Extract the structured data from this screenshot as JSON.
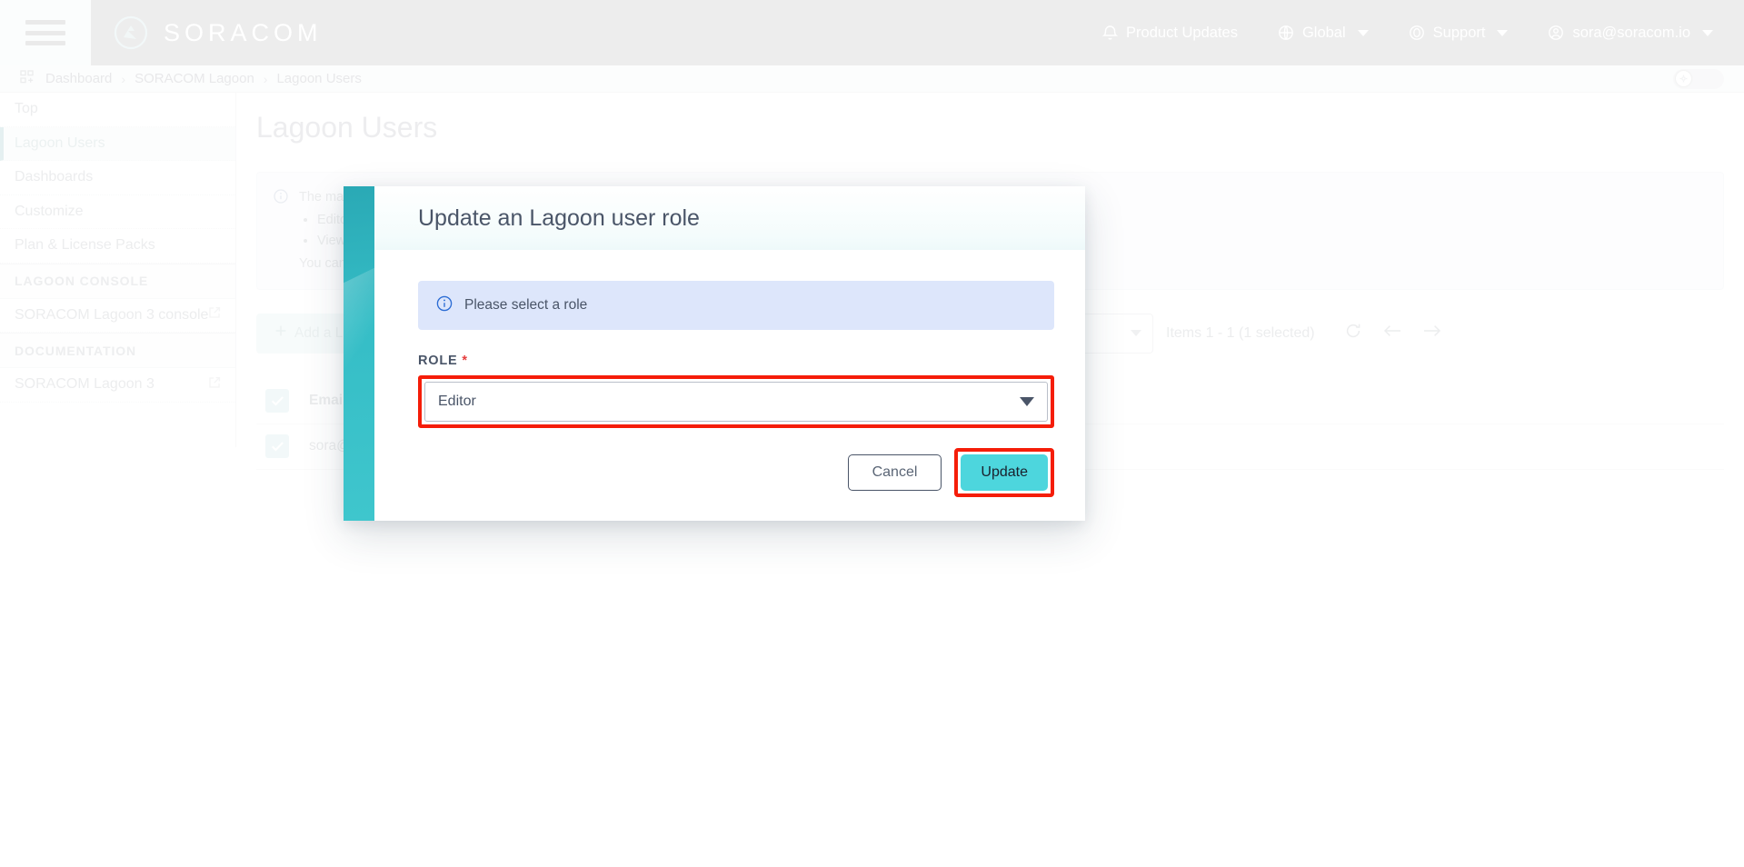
{
  "header": {
    "brand": "SORACOM",
    "menu_icon": "hamburger-icon",
    "logo_icon": "soracom-logo-icon",
    "items": [
      {
        "label": "Product Updates",
        "icon": "bell-icon",
        "has_caret": false
      },
      {
        "label": "Global",
        "icon": "globe-icon",
        "has_caret": true
      },
      {
        "label": "Support",
        "icon": "lifebuoy-icon",
        "has_caret": true
      },
      {
        "label": "sora@soracom.io",
        "icon": "user-circle-icon",
        "has_caret": true
      }
    ]
  },
  "breadcrumb": {
    "icon": "dashboard-grid-icon",
    "items": [
      "Dashboard",
      "SORACOM Lagoon",
      "Lagoon Users"
    ],
    "separator": "›"
  },
  "sidebar": {
    "items": [
      {
        "label": "Top",
        "active": false,
        "external": false
      },
      {
        "label": "Lagoon Users",
        "active": true,
        "external": false
      },
      {
        "label": "Dashboards",
        "active": false,
        "external": false
      },
      {
        "label": "Customize",
        "active": false,
        "external": false
      },
      {
        "label": "Plan & License Packs",
        "active": false,
        "external": false
      }
    ],
    "groups": [
      {
        "title": "LAGOON CONSOLE",
        "items": [
          {
            "label": "SORACOM Lagoon 3 console",
            "external": true
          }
        ]
      },
      {
        "title": "DOCUMENTATION",
        "items": [
          {
            "label": "SORACOM Lagoon 3",
            "external": true
          }
        ]
      }
    ]
  },
  "main": {
    "page_title": "Lagoon Users",
    "notice": {
      "icon": "info-circle-icon",
      "text": "The maximum number of users you can create with your subscription plan is as follows (current/limit):",
      "bullets": [
        "Editor",
        "Viewer"
      ],
      "footer": "You can"
    },
    "toolbar": {
      "add_button": "Add a Lagoon user",
      "add_icon": "plus-icon",
      "count_text": "Items 1 - 1 (1 selected)",
      "refresh_icon": "refresh-icon",
      "prev_icon": "arrow-left-icon",
      "next_icon": "arrow-right-icon"
    },
    "table": {
      "header": [
        "Email"
      ],
      "rows": [
        {
          "cells": [
            "sora@"
          ],
          "checked": true
        }
      ],
      "header_checked": true,
      "check_icon": "checkmark-icon"
    }
  },
  "modal": {
    "title": "Update an Lagoon user role",
    "info": {
      "icon": "info-circle-icon",
      "text": "Please select a role"
    },
    "field": {
      "label": "ROLE",
      "required_marker": "*",
      "value": "Editor",
      "caret_icon": "chevron-down-icon"
    },
    "cancel_label": "Cancel",
    "update_label": "Update"
  },
  "colors": {
    "accent_teal": "#35bdc6",
    "update_button": "#4dd6dd",
    "annotation_red": "#f51d09",
    "info_blue_bg": "#dde6fb",
    "header_grey": "#c9c9c9"
  }
}
